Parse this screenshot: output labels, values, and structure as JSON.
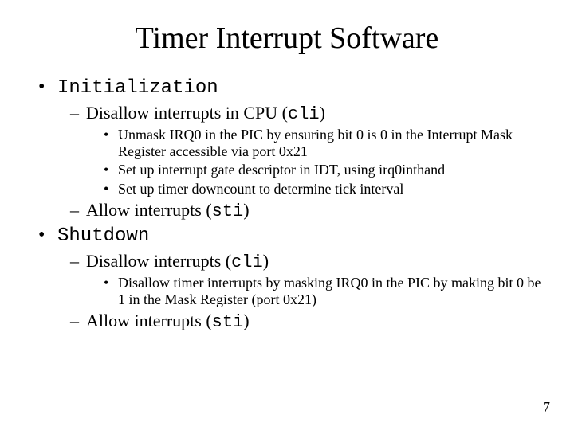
{
  "title": "Timer Interrupt Software",
  "bullets": {
    "init_label": "Initialization",
    "init_sub1_pre": "Disallow interrupts in CPU (",
    "init_sub1_code": "cli",
    "init_sub1_post": ")",
    "init_sub1_a": "Unmask IRQ0 in the PIC by ensuring bit 0 is 0 in the Interrupt Mask Register accessible via port 0x21",
    "init_sub1_b": "Set up interrupt gate descriptor in IDT, using irq0inthand",
    "init_sub1_c": "Set up timer downcount to determine tick interval",
    "init_sub2_pre": "Allow interrupts (",
    "init_sub2_code": "sti",
    "init_sub2_post": ")",
    "shutdown_label": "Shutdown",
    "shut_sub1_pre": "Disallow interrupts (",
    "shut_sub1_code": "cli",
    "shut_sub1_post": ")",
    "shut_sub1_a": "Disallow timer interrupts by masking IRQ0 in the PIC by making bit 0 be 1 in the Mask Register (port 0x21)",
    "shut_sub2_pre": "Allow interrupts (",
    "shut_sub2_code": "sti",
    "shut_sub2_post": ")"
  },
  "page_number": "7"
}
